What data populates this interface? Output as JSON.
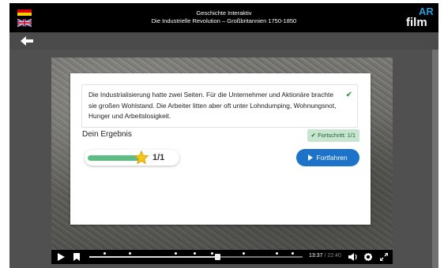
{
  "header": {
    "title": "Geschichte Interaktiv",
    "subtitle": "Die Industrielle Revolution – Großbritannien 1750-1850",
    "logo_text": "film",
    "logo_accent": "AR"
  },
  "feedback": {
    "text": "Die Industrialisierung hatte zwei Seiten. Für die Unternehmer und Aktionäre brachte sie großen Wohlstand. Die Arbeiter litten aber oft unter Lohndumping, Wohnungsnot, Hunger und Arbeitslosigkeit.",
    "check_icon": "check-icon"
  },
  "result": {
    "label": "Dein Ergebnis",
    "progress_badge": "Fortschritt: 1/1",
    "score": "1/1",
    "score_fraction": 1.0,
    "continue_label": "Fortfahren"
  },
  "player": {
    "current_time": "13:37",
    "duration": "22:40",
    "time_separator": "/",
    "progress_fraction": 0.6
  },
  "colors": {
    "header_bg": "#000000",
    "nav_bg": "#4a4a4a",
    "accent_blue": "#1c73c9",
    "success_green": "#5dbd84",
    "badge_bg": "#c8e6cf",
    "star": "#f5c518"
  }
}
